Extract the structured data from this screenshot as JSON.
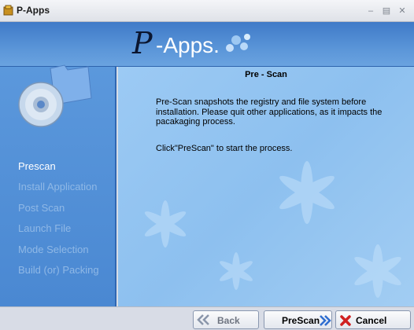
{
  "window": {
    "title": "P-Apps",
    "minimize_icon": "minimize-icon",
    "maximize_icon": "maximize-icon",
    "close_icon": "close-icon"
  },
  "banner": {
    "logo_p": "P",
    "logo_rest": "-Apps."
  },
  "sidebar": {
    "steps": [
      {
        "label": "Prescan",
        "active": true
      },
      {
        "label": "Install Application",
        "active": false
      },
      {
        "label": "Post Scan",
        "active": false
      },
      {
        "label": "Launch File",
        "active": false
      },
      {
        "label": "Mode Selection",
        "active": false
      },
      {
        "label": "Build (or) Packing",
        "active": false
      }
    ]
  },
  "content": {
    "title": "Pre - Scan",
    "paragraph": "Pre-Scan snapshots the registry and file system before installation. Please quit other applications, as it impacts the pacakaging process.",
    "instruction": "Click\"PreScan\" to start the process."
  },
  "footer": {
    "back_label": "Back",
    "prescan_label": "PreScan",
    "cancel_label": "Cancel"
  },
  "colors": {
    "banner": "#4a88d2",
    "content_bg": "#9ccaf4",
    "active_step": "#ffffff",
    "inactive_step": "#8fb8e6"
  }
}
